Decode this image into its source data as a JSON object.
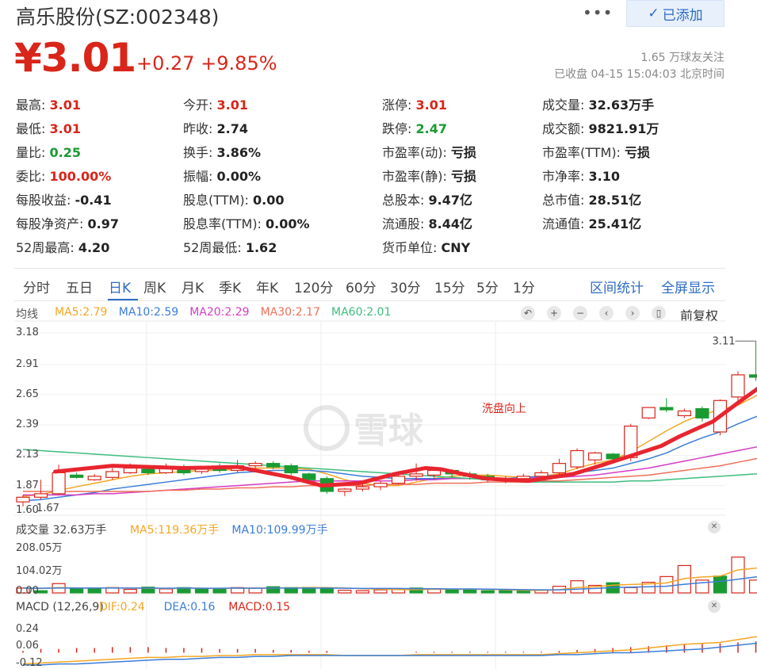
{
  "header": {
    "title": "高乐股份(SZ:002348)",
    "more_label": "•••",
    "follow_label": "已添加",
    "price": "¥3.01",
    "change": "+0.27 +9.85%",
    "followers": "1.65 万球友关注",
    "status": "已收盘 04-15 15:04:03 北京时间"
  },
  "quote": {
    "col1": [
      {
        "label": "最高:",
        "value": "3.01",
        "tone": "red"
      },
      {
        "label": "最低:",
        "value": "3.01",
        "tone": "red"
      },
      {
        "label": "量比:",
        "value": "0.25",
        "tone": "green"
      },
      {
        "label": "委比:",
        "value": "100.00%",
        "tone": "red"
      },
      {
        "label": "每股收益:",
        "value": "-0.41",
        "tone": ""
      },
      {
        "label": "每股净资产:",
        "value": "0.97",
        "tone": ""
      },
      {
        "label": "52周最高:",
        "value": "4.20",
        "tone": ""
      }
    ],
    "col2": [
      {
        "label": "今开:",
        "value": "3.01",
        "tone": "red"
      },
      {
        "label": "昨收:",
        "value": "2.74",
        "tone": ""
      },
      {
        "label": "换手:",
        "value": "3.86%",
        "tone": ""
      },
      {
        "label": "振幅:",
        "value": "0.00%",
        "tone": ""
      },
      {
        "label": "股息(TTM):",
        "value": "0.00",
        "tone": ""
      },
      {
        "label": "股息率(TTM):",
        "value": "0.00%",
        "tone": ""
      },
      {
        "label": "52周最低:",
        "value": "1.62",
        "tone": ""
      }
    ],
    "col3": [
      {
        "label": "涨停:",
        "value": "3.01",
        "tone": "red"
      },
      {
        "label": "跌停:",
        "value": "2.47",
        "tone": "green"
      },
      {
        "label": "市盈率(动):",
        "value": "亏损",
        "tone": ""
      },
      {
        "label": "市盈率(静):",
        "value": "亏损",
        "tone": ""
      },
      {
        "label": "总股本:",
        "value": "9.47亿",
        "tone": ""
      },
      {
        "label": "流通股:",
        "value": "8.44亿",
        "tone": ""
      },
      {
        "label": "货币单位:",
        "value": "CNY",
        "tone": ""
      }
    ],
    "col4": [
      {
        "label": "成交量:",
        "value": "32.63万手",
        "tone": ""
      },
      {
        "label": "成交额:",
        "value": "9821.91万",
        "tone": ""
      },
      {
        "label": "市盈率(TTM):",
        "value": "亏损",
        "tone": ""
      },
      {
        "label": "市净率:",
        "value": "3.10",
        "tone": ""
      },
      {
        "label": "总市值:",
        "value": "28.51亿",
        "tone": ""
      },
      {
        "label": "流通值:",
        "value": "25.41亿",
        "tone": ""
      }
    ]
  },
  "tabs": [
    "分时",
    "五日",
    "日K",
    "周K",
    "月K",
    "季K",
    "年K",
    "120分",
    "60分",
    "30分",
    "15分",
    "5分",
    "1分"
  ],
  "active_tab": "日K",
  "right_tabs": [
    "区间统计",
    "全屏显示"
  ],
  "ma_legend": {
    "label": "均线",
    "items": [
      {
        "text": "MA5:2.79",
        "color": "#f5a623"
      },
      {
        "text": "MA10:2.59",
        "color": "#3b7dd8"
      },
      {
        "text": "MA20:2.29",
        "color": "#d43cc4"
      },
      {
        "text": "MA30:2.17",
        "color": "#f0705a"
      },
      {
        "text": "MA60:2.01",
        "color": "#3dbd7d"
      }
    ]
  },
  "controls": {
    "icons": [
      "undo-icon",
      "zoom-in-icon",
      "zoom-out-icon",
      "prev-icon",
      "next-icon",
      "candle-icon"
    ],
    "glyphs": [
      "↶",
      "+",
      "−",
      "‹",
      "›",
      "▯"
    ],
    "adjust_label": "前复权"
  },
  "volume_legend": {
    "label": "成交量 32.63万手",
    "items": [
      {
        "text": "MA5:119.36万手",
        "color": "#f5a623"
      },
      {
        "text": "MA10:109.99万手",
        "color": "#3b7dd8"
      }
    ]
  },
  "macd_legend": {
    "label": "MACD (12,26,9)",
    "items": [
      {
        "text": "DIF:0.24",
        "color": "#f5a623"
      },
      {
        "text": "DEA:0.16",
        "color": "#3b7dd8"
      },
      {
        "text": "MACD:0.15",
        "color": "#d8261a"
      }
    ]
  },
  "watermark": "雪球",
  "annotation": "洗盘向上",
  "chart_data": [
    {
      "type": "candlestick",
      "y_ticks": [
        "3.18",
        "2.91",
        "2.65",
        "2.39",
        "2.13",
        "1.87",
        "1.67"
      ],
      "ylim": [
        1.67,
        3.18
      ],
      "max_label": "3.11",
      "min_label": "1.60",
      "colors": {
        "up": "#d8261a",
        "down": "#1a9a33"
      },
      "candles": [
        [
          1.73,
          1.77,
          1.69,
          1.79
        ],
        [
          1.77,
          1.8,
          1.75,
          1.92
        ],
        [
          1.8,
          1.98,
          1.79,
          2.05
        ],
        [
          1.96,
          1.94,
          1.93,
          1.98
        ],
        [
          1.92,
          1.95,
          1.91,
          1.97
        ],
        [
          1.94,
          1.99,
          1.92,
          2.02
        ],
        [
          1.98,
          2.02,
          1.97,
          2.06
        ],
        [
          2.01,
          1.98,
          1.96,
          2.04
        ],
        [
          1.98,
          2.03,
          1.97,
          2.06
        ],
        [
          2.03,
          1.98,
          1.96,
          2.05
        ],
        [
          1.99,
          2.02,
          1.97,
          2.03
        ],
        [
          2.01,
          2.0,
          1.98,
          2.06
        ],
        [
          2.0,
          2.04,
          1.98,
          2.09
        ],
        [
          2.04,
          2.06,
          2.02,
          2.08
        ],
        [
          2.06,
          2.03,
          2.01,
          2.08
        ],
        [
          2.04,
          1.98,
          1.96,
          2.06
        ],
        [
          1.97,
          1.92,
          1.88,
          1.98
        ],
        [
          1.93,
          1.82,
          1.8,
          1.95
        ],
        [
          1.82,
          1.84,
          1.78,
          1.85
        ],
        [
          1.84,
          1.86,
          1.82,
          1.89
        ],
        [
          1.86,
          1.89,
          1.83,
          1.91
        ],
        [
          1.89,
          1.95,
          1.88,
          1.97
        ],
        [
          1.95,
          1.97,
          1.91,
          2.06
        ],
        [
          1.96,
          2.0,
          1.93,
          2.03
        ],
        [
          2.0,
          1.97,
          1.94,
          2.01
        ],
        [
          1.97,
          1.95,
          1.92,
          1.99
        ],
        [
          1.95,
          1.92,
          1.9,
          1.97
        ],
        [
          1.92,
          1.93,
          1.89,
          1.95
        ],
        [
          1.93,
          1.95,
          1.91,
          1.97
        ],
        [
          1.95,
          1.98,
          1.93,
          2.0
        ],
        [
          1.98,
          2.06,
          1.96,
          2.1
        ],
        [
          2.03,
          2.17,
          2.01,
          2.19
        ],
        [
          2.09,
          2.15,
          2.05,
          2.16
        ],
        [
          2.14,
          2.1,
          2.07,
          2.15
        ],
        [
          2.11,
          2.38,
          2.08,
          2.4
        ],
        [
          2.45,
          2.54,
          2.44,
          2.54
        ],
        [
          2.54,
          2.52,
          2.5,
          2.62
        ],
        [
          2.47,
          2.51,
          2.45,
          2.53
        ],
        [
          2.53,
          2.45,
          2.42,
          2.55
        ],
        [
          2.33,
          2.6,
          2.3,
          2.61
        ],
        [
          2.63,
          2.82,
          2.58,
          2.85
        ],
        [
          2.82,
          2.8,
          2.77,
          3.11
        ],
        [
          2.78,
          2.74,
          2.6,
          2.86
        ],
        [
          3.01,
          3.01,
          3.01,
          3.01
        ]
      ],
      "series": [
        {
          "name": "MA5",
          "color": "#f5a623",
          "values": [
            1.78,
            1.79,
            1.83,
            1.86,
            1.89,
            1.92,
            1.95,
            1.97,
            1.98,
            1.99,
            2.0,
            2.0,
            2.01,
            2.02,
            2.02,
            2.02,
            2.01,
            1.97,
            1.92,
            1.89,
            1.87,
            1.87,
            1.9,
            1.93,
            1.95,
            1.96,
            1.96,
            1.95,
            1.94,
            1.95,
            1.97,
            2.02,
            2.06,
            2.09,
            2.16,
            2.25,
            2.34,
            2.42,
            2.48,
            2.52,
            2.56,
            2.64,
            2.72,
            2.79
          ]
        },
        {
          "name": "MA10",
          "color": "#3b7dd8",
          "values": [
            1.74,
            1.75,
            1.77,
            1.79,
            1.81,
            1.84,
            1.86,
            1.88,
            1.9,
            1.92,
            1.94,
            1.96,
            1.98,
            1.99,
            2.0,
            2.0,
            2.0,
            1.99,
            1.97,
            1.95,
            1.94,
            1.93,
            1.93,
            1.93,
            1.93,
            1.93,
            1.93,
            1.93,
            1.94,
            1.95,
            1.96,
            1.98,
            2.0,
            2.02,
            2.06,
            2.1,
            2.15,
            2.22,
            2.28,
            2.33,
            2.4,
            2.46,
            2.52,
            2.59
          ]
        },
        {
          "name": "MA20",
          "color": "#d43cc4",
          "values": [
            1.79,
            1.79,
            1.79,
            1.79,
            1.8,
            1.8,
            1.81,
            1.82,
            1.83,
            1.84,
            1.85,
            1.86,
            1.87,
            1.88,
            1.89,
            1.9,
            1.91,
            1.91,
            1.91,
            1.91,
            1.91,
            1.91,
            1.92,
            1.92,
            1.93,
            1.93,
            1.93,
            1.93,
            1.93,
            1.94,
            1.94,
            1.95,
            1.96,
            1.98,
            2.0,
            2.02,
            2.05,
            2.08,
            2.11,
            2.14,
            2.17,
            2.2,
            2.25,
            2.29
          ]
        },
        {
          "name": "MA30",
          "color": "#f0705a",
          "values": [
            1.82,
            1.82,
            1.82,
            1.82,
            1.82,
            1.82,
            1.82,
            1.82,
            1.83,
            1.83,
            1.84,
            1.84,
            1.85,
            1.85,
            1.86,
            1.86,
            1.87,
            1.87,
            1.87,
            1.87,
            1.88,
            1.88,
            1.88,
            1.89,
            1.89,
            1.89,
            1.9,
            1.9,
            1.9,
            1.91,
            1.91,
            1.92,
            1.93,
            1.94,
            1.95,
            1.96,
            1.98,
            2.0,
            2.02,
            2.04,
            2.07,
            2.1,
            2.13,
            2.17
          ]
        },
        {
          "name": "MA60",
          "color": "#3dbd7d",
          "values": [
            2.18,
            2.17,
            2.16,
            2.15,
            2.14,
            2.13,
            2.12,
            2.11,
            2.1,
            2.09,
            2.08,
            2.07,
            2.06,
            2.05,
            2.04,
            2.03,
            2.02,
            2.01,
            2.0,
            1.99,
            1.98,
            1.97,
            1.96,
            1.95,
            1.94,
            1.93,
            1.92,
            1.91,
            1.9,
            1.9,
            1.9,
            1.9,
            1.9,
            1.9,
            1.91,
            1.91,
            1.92,
            1.93,
            1.94,
            1.95,
            1.96,
            1.97,
            1.99,
            2.01
          ]
        }
      ],
      "trend_path": [
        [
          1.99,
          2.8
        ],
        [
          2.04,
          6
        ],
        [
          2.02,
          10
        ],
        [
          2.03,
          13
        ],
        [
          1.94,
          16
        ],
        [
          1.87,
          17.7
        ],
        [
          1.89,
          19.8
        ],
        [
          1.97,
          21.8
        ],
        [
          2.02,
          23.5
        ],
        [
          2.01,
          24.4
        ],
        [
          1.97,
          25.6
        ],
        [
          1.93,
          26.9
        ],
        [
          1.92,
          28
        ],
        [
          1.91,
          29.3
        ],
        [
          1.97,
          31.8
        ],
        [
          2.06,
          33.7
        ],
        [
          2.21,
          36.7
        ],
        [
          2.29,
          37.7
        ],
        [
          2.42,
          39.6
        ],
        [
          2.58,
          41
        ],
        [
          2.79,
          42.9
        ],
        [
          3.0,
          44.5
        ],
        [
          3.43,
          45
        ]
      ]
    },
    {
      "type": "bar",
      "name": "成交量",
      "y_ticks": [
        "208.05万",
        "104.02万",
        "0.00"
      ],
      "ylim": [
        0,
        208.05
      ],
      "values": [
        22,
        10,
        42,
        18,
        20,
        24,
        16,
        26,
        18,
        24,
        20,
        18,
        24,
        22,
        28,
        24,
        25,
        22,
        12,
        10,
        14,
        16,
        22,
        18,
        16,
        14,
        10,
        12,
        10,
        12,
        30,
        55,
        34,
        46,
        24,
        48,
        74,
        124,
        58,
        76,
        162,
        58,
        112,
        210,
        108
      ],
      "tones": [
        "u",
        "d",
        "u",
        "d",
        "d",
        "u",
        "u",
        "d",
        "u",
        "d",
        "d",
        "d",
        "u",
        "u",
        "d",
        "d",
        "d",
        "d",
        "u",
        "u",
        "u",
        "u",
        "d",
        "u",
        "d",
        "d",
        "d",
        "d",
        "d",
        "u",
        "u",
        "u",
        "u",
        "d",
        "u",
        "u",
        "u",
        "u",
        "u",
        "d",
        "u",
        "u",
        "u",
        "d",
        "u"
      ],
      "series": [
        {
          "name": "MA5",
          "color": "#f5a623",
          "values": [
            22,
            20,
            24,
            22,
            22,
            23,
            22,
            21,
            20,
            22,
            21,
            20,
            22,
            21,
            22,
            23,
            24,
            24,
            22,
            19,
            17,
            15,
            15,
            16,
            17,
            17,
            16,
            14,
            12,
            11,
            15,
            24,
            28,
            35,
            38,
            41,
            45,
            65,
            72,
            76,
            104,
            112,
            120,
            136,
            119.36
          ]
        },
        {
          "name": "MA10",
          "color": "#3b7dd8",
          "values": [
            22,
            21,
            22,
            22,
            22,
            22,
            22,
            22,
            21,
            22,
            21,
            21,
            22,
            21,
            22,
            22,
            22,
            22,
            21,
            20,
            20,
            20,
            19,
            19,
            18,
            18,
            17,
            16,
            15,
            14,
            14,
            17,
            20,
            24,
            26,
            28,
            30,
            39,
            46,
            52,
            62,
            72,
            82,
            98,
            109.99
          ]
        }
      ]
    },
    {
      "type": "line",
      "name": "MACD",
      "y_ticks": [
        "0.24",
        "0.06",
        "-0.12"
      ],
      "ylim": [
        -0.14,
        0.3
      ],
      "series": [
        {
          "name": "DIF",
          "color": "#f5a623",
          "values": [
            -0.12,
            -0.11,
            -0.1,
            -0.09,
            -0.08,
            -0.07,
            -0.06,
            -0.05,
            -0.05,
            -0.04,
            -0.04,
            -0.03,
            -0.03,
            -0.02,
            -0.02,
            -0.02,
            -0.02,
            -0.02,
            -0.03,
            -0.03,
            -0.03,
            -0.03,
            -0.02,
            -0.02,
            -0.02,
            -0.02,
            -0.02,
            -0.02,
            -0.02,
            -0.02,
            -0.01,
            0.0,
            0.01,
            0.02,
            0.03,
            0.05,
            0.07,
            0.09,
            0.1,
            0.11,
            0.14,
            0.17,
            0.2,
            0.22,
            0.24
          ]
        },
        {
          "name": "DEA",
          "color": "#3b7dd8",
          "values": [
            -0.13,
            -0.13,
            -0.12,
            -0.12,
            -0.11,
            -0.1,
            -0.09,
            -0.08,
            -0.07,
            -0.07,
            -0.06,
            -0.05,
            -0.05,
            -0.04,
            -0.04,
            -0.03,
            -0.03,
            -0.03,
            -0.03,
            -0.03,
            -0.03,
            -0.03,
            -0.03,
            -0.03,
            -0.03,
            -0.03,
            -0.03,
            -0.03,
            -0.03,
            -0.03,
            -0.02,
            -0.02,
            -0.01,
            0.0,
            0.0,
            0.01,
            0.02,
            0.03,
            0.04,
            0.06,
            0.08,
            0.1,
            0.12,
            0.14,
            0.16
          ]
        }
      ],
      "macd": [
        0.02,
        0.04,
        0.04,
        0.05,
        0.05,
        0.06,
        0.06,
        0.06,
        0.05,
        0.05,
        0.05,
        0.04,
        0.04,
        0.04,
        0.03,
        0.03,
        0.02,
        0.02,
        0.0,
        0.0,
        0.0,
        0.0,
        0.01,
        0.01,
        0.01,
        0.01,
        0.01,
        0.01,
        0.01,
        0.01,
        0.02,
        0.03,
        0.04,
        0.05,
        0.06,
        0.07,
        0.08,
        0.09,
        0.1,
        0.1,
        0.11,
        0.12,
        0.13,
        0.14,
        0.15
      ]
    }
  ]
}
